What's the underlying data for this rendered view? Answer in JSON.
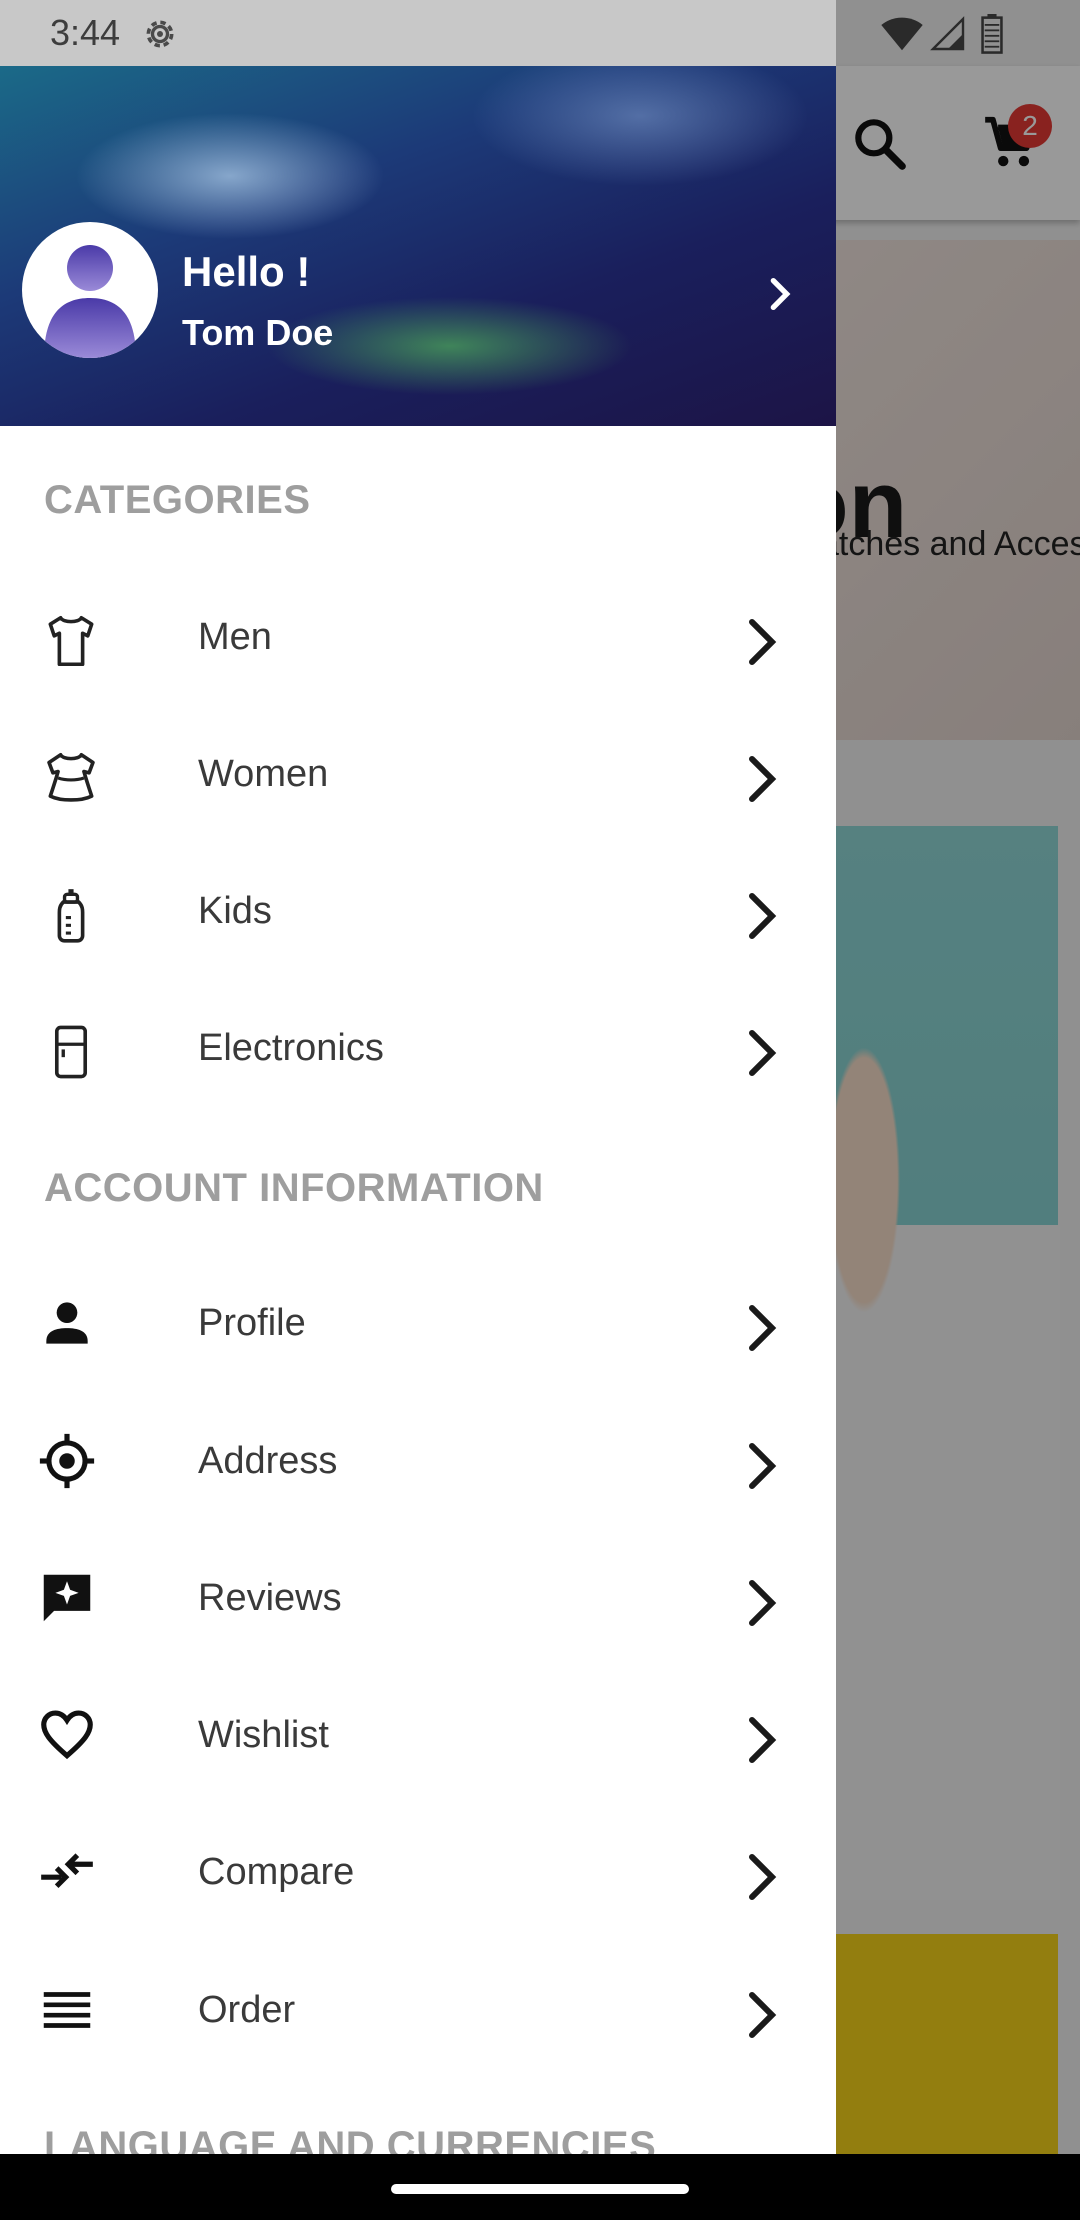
{
  "status_bar": {
    "time": "3:44"
  },
  "background": {
    "cart_count": "2",
    "banner_title": "on",
    "banner_subtitle": "atches and Accesorie"
  },
  "drawer": {
    "header": {
      "greeting": "Hello !",
      "name": "Tom Doe"
    },
    "categories": {
      "title": "CATEGORIES",
      "items": [
        {
          "label": "Men",
          "icon": "tshirt-icon"
        },
        {
          "label": "Women",
          "icon": "dress-icon"
        },
        {
          "label": "Kids",
          "icon": "baby-bottle-icon"
        },
        {
          "label": "Electronics",
          "icon": "fridge-icon"
        }
      ]
    },
    "account": {
      "title": "ACCOUNT INFORMATION",
      "items": [
        {
          "label": "Profile",
          "icon": "person-icon"
        },
        {
          "label": "Address",
          "icon": "location-target-icon"
        },
        {
          "label": "Reviews",
          "icon": "review-icon"
        },
        {
          "label": "Wishlist",
          "icon": "heart-icon"
        },
        {
          "label": "Compare",
          "icon": "compare-arrows-icon"
        },
        {
          "label": "Order",
          "icon": "list-icon"
        }
      ]
    },
    "language_section_title": "LANGUAGE AND CURRENCIES"
  },
  "colors": {
    "section_title": "#9e9e9e",
    "menu_text": "#3a3a3a",
    "cart_badge": "#e53935",
    "header_dark": "#1a1f5c"
  }
}
